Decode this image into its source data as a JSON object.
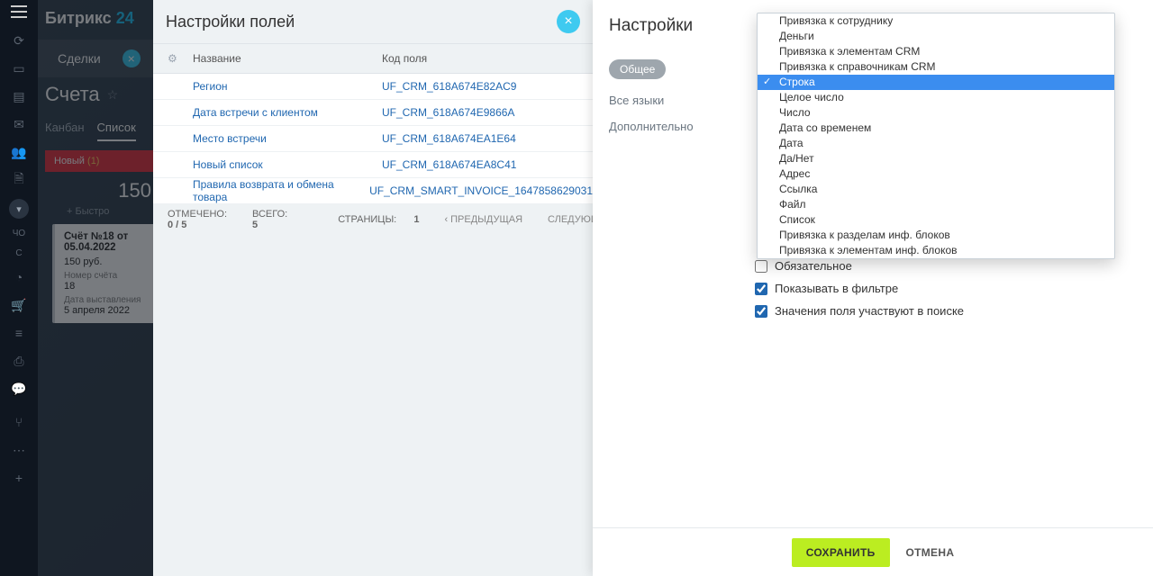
{
  "app": {
    "logo1": "Битрикс",
    "logo2": "24"
  },
  "appbar_text": {
    "cho": "ЧО",
    "s": "С"
  },
  "bg": {
    "tab": "Сделки",
    "title": "Счета",
    "subtab_kanban": "Канбан",
    "subtab_list": "Список",
    "status": "Новый",
    "status_count": "(1)",
    "sum": "150",
    "quick": "+ Быстро",
    "card": {
      "title": "Счёт №18 от 05.04.2022",
      "price": "150 руб.",
      "num_lbl": "Номер счёта",
      "num": "18",
      "date_lbl": "Дата выставления",
      "date": "5 апреля 2022"
    }
  },
  "modal1": {
    "title": "Настройки полей",
    "col_name": "Название",
    "col_code": "Код поля",
    "rows": [
      {
        "name": "Регион",
        "code": "UF_CRM_618A674E82AC9"
      },
      {
        "name": "Дата встречи с клиентом",
        "code": "UF_CRM_618A674E9866A"
      },
      {
        "name": "Место встречи",
        "code": "UF_CRM_618A674EA1E64"
      },
      {
        "name": "Новый список",
        "code": "UF_CRM_618A674EA8C41"
      },
      {
        "name": "Правила возврата и обмена товара",
        "code": "UF_CRM_SMART_INVOICE_1647858629031"
      }
    ],
    "foot_marked": "ОТМЕЧЕНО:",
    "foot_marked_v": "0 / 5",
    "foot_total": "ВСЕГО:",
    "foot_total_v": "5",
    "foot_pages": "СТРАНИЦЫ:",
    "foot_pages_v": "1",
    "foot_prev": "ПРЕДЫДУЩАЯ",
    "foot_next": "СЛЕДУЮЩАЯ"
  },
  "panel2": {
    "title": "Настройки",
    "side_general": "Общее",
    "side_lang": "Все языки",
    "side_more": "Дополнительно",
    "chk_mandatory": "Обязательное",
    "chk_filter": "Показывать в фильтре",
    "chk_search": "Значения поля участвуют в поиске",
    "btn_save": "СОХРАНИТЬ",
    "btn_cancel": "ОТМЕНА"
  },
  "dropdown": {
    "selected": "Строка",
    "items": [
      "Привязка к сотруднику",
      "Деньги",
      "Привязка к элементам CRM",
      "Привязка к справочникам CRM",
      "Строка",
      "Целое число",
      "Число",
      "Дата со временем",
      "Дата",
      "Да/Нет",
      "Адрес",
      "Ссылка",
      "Файл",
      "Список",
      "Привязка к разделам инф. блоков",
      "Привязка к элементам инф. блоков"
    ]
  }
}
